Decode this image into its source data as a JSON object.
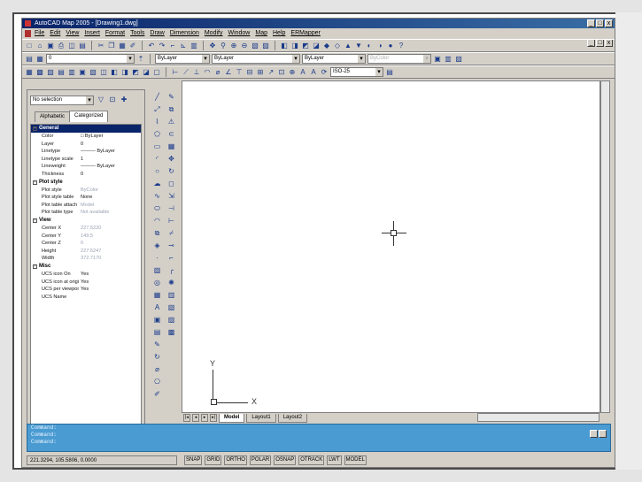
{
  "window": {
    "title": "AutoCAD Map 2005 - [Drawing1.dwg]",
    "controls": [
      "_",
      "□",
      "x"
    ]
  },
  "menubar": [
    "File",
    "Edit",
    "View",
    "Insert",
    "Format",
    "Tools",
    "Draw",
    "Dimension",
    "Modify",
    "Window",
    "Map",
    "Help",
    "ERMapper"
  ],
  "toolbar_layers": {
    "layer_combo": "0",
    "color_combo": "ByLayer",
    "linetype_combo": "ByLayer",
    "lineweight_combo": "ByLayer",
    "plotstyle_combo": "ByColor"
  },
  "toolbar_dims": {
    "dimstyle_combo": "ISO-25"
  },
  "properties": {
    "selection": "No selection",
    "tabs": [
      "Alphabetic",
      "Categorized"
    ],
    "active_tab": "Categorized",
    "categories": [
      {
        "name": "General",
        "selected": true,
        "rows": [
          {
            "k": "Color",
            "v": "□ ByLayer"
          },
          {
            "k": "Layer",
            "v": "0"
          },
          {
            "k": "Linetype",
            "v": "——— ByLayer"
          },
          {
            "k": "Linetype scale",
            "v": "1"
          },
          {
            "k": "Lineweight",
            "v": "——— ByLayer"
          },
          {
            "k": "Thickness",
            "v": "0"
          }
        ]
      },
      {
        "name": "Plot style",
        "selected": false,
        "rows": [
          {
            "k": "Plot style",
            "v": "ByColor",
            "dim": true
          },
          {
            "k": "Plot style table",
            "v": "None"
          },
          {
            "k": "Plot table attach",
            "v": "Model",
            "dim": true
          },
          {
            "k": "Plot table type",
            "v": "Not available",
            "dim": true
          }
        ]
      },
      {
        "name": "View",
        "selected": false,
        "rows": [
          {
            "k": "Center X",
            "v": "227.5220",
            "dim": true
          },
          {
            "k": "Center Y",
            "v": "149.5",
            "dim": true
          },
          {
            "k": "Center Z",
            "v": "0",
            "dim": true
          },
          {
            "k": "Height",
            "v": "227.5247",
            "dim": true
          },
          {
            "k": "Width",
            "v": "372.7170",
            "dim": true
          }
        ]
      },
      {
        "name": "Misc",
        "selected": false,
        "rows": [
          {
            "k": "UCS icon On",
            "v": "Yes"
          },
          {
            "k": "UCS icon at origi",
            "v": "Yes"
          },
          {
            "k": "UCS per viewpor",
            "v": "Yes"
          },
          {
            "k": "UCS Name",
            "v": ""
          }
        ]
      }
    ]
  },
  "canvas": {
    "ucs_x": "X",
    "ucs_y": "Y"
  },
  "layout_tabs": {
    "tabs": [
      "Model",
      "Layout1",
      "Layout2"
    ],
    "active": "Model",
    "nav": [
      "|◂",
      "◂",
      "▸",
      "▸|"
    ]
  },
  "command_window": {
    "lines": [
      "Command:",
      "Command:",
      "Command:"
    ]
  },
  "statusbar": {
    "coords": "221.3294, 105.5806, 0.0000",
    "modes": [
      "SNAP",
      "GRID",
      "ORTHO",
      "POLAR",
      "OSNAP",
      "OTRACK",
      "LWT",
      "MODEL"
    ]
  },
  "icons": {
    "toolbar1": [
      "new-icon",
      "open-icon",
      "save-icon",
      "print-icon",
      "preview-icon",
      "publish-icon",
      "cut-icon",
      "copy-icon",
      "paste-icon",
      "matchprop-icon",
      "undo-icon",
      "redo-icon",
      "pan-icon",
      "zoom-realtime-icon",
      "zoom-window-icon",
      "zoom-previous-icon",
      "properties-icon",
      "designcenter-icon",
      "toolpalette-icon",
      "help-icon"
    ],
    "draw": [
      "line-icon",
      "construction-line-icon",
      "polyline-icon",
      "polygon-icon",
      "rectangle-icon",
      "arc-icon",
      "circle-icon",
      "revcloud-icon",
      "spline-icon",
      "ellipse-icon",
      "ellipse-arc-icon",
      "insert-block-icon",
      "make-block-icon",
      "point-icon",
      "hatch-icon",
      "region-icon",
      "table-icon",
      "mtext-icon"
    ],
    "modify": [
      "erase-icon",
      "copy-object-icon",
      "mirror-icon",
      "offset-icon",
      "array-icon",
      "move-icon",
      "rotate-icon",
      "scale-icon",
      "stretch-icon",
      "trim-icon",
      "extend-icon",
      "break-icon",
      "join-icon",
      "chamfer-icon",
      "fillet-icon",
      "explode-icon"
    ]
  }
}
